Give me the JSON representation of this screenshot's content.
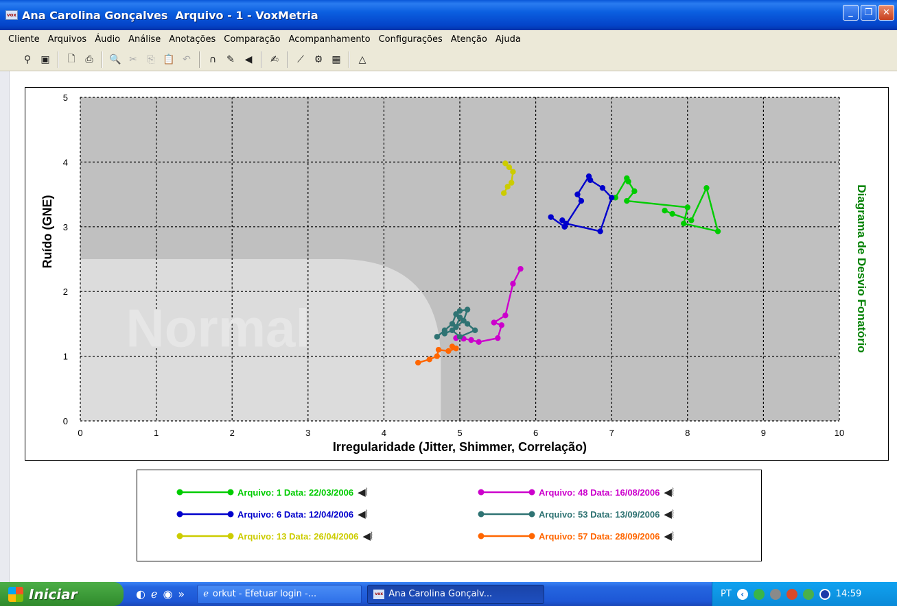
{
  "window": {
    "title": "Ana Carolina Gonçalves  Arquivo - 1 - VoxMetria",
    "icon": "vox",
    "buttons": {
      "minimize": "_",
      "maximize": "❐",
      "close": "✕"
    }
  },
  "menu": [
    "Cliente",
    "Arquivos",
    "Áudio",
    "Análise",
    "Anotações",
    "Comparação",
    "Acompanhamento",
    "Configurações",
    "Atenção",
    "Ajuda"
  ],
  "toolbar": [
    {
      "icon": "patient-icon",
      "glyph": "⚲"
    },
    {
      "icon": "monitor-icon",
      "glyph": "▣"
    },
    {
      "sep": true
    },
    {
      "icon": "print-preview-icon",
      "glyph": "🗋"
    },
    {
      "icon": "print-icon",
      "glyph": "⎙"
    },
    {
      "sep": true
    },
    {
      "icon": "zoom-icon",
      "glyph": "🔍",
      "disabled": true
    },
    {
      "icon": "cut-icon",
      "glyph": "✂",
      "disabled": true
    },
    {
      "icon": "copy-icon",
      "glyph": "⎘",
      "disabled": true
    },
    {
      "icon": "paste-icon",
      "glyph": "📋",
      "disabled": true
    },
    {
      "icon": "undo-icon",
      "glyph": "↶",
      "disabled": true
    },
    {
      "sep": true
    },
    {
      "icon": "headphones-icon",
      "glyph": "∩"
    },
    {
      "icon": "microphone-icon",
      "glyph": "✎"
    },
    {
      "icon": "speaker-icon",
      "glyph": "◀"
    },
    {
      "sep": true
    },
    {
      "icon": "notes-icon",
      "glyph": "✍"
    },
    {
      "sep": true
    },
    {
      "icon": "diagram-icon",
      "glyph": "⟋"
    },
    {
      "icon": "settings-icon",
      "glyph": "⚙"
    },
    {
      "icon": "spectrogram-icon",
      "glyph": "▦"
    },
    {
      "sep": true
    },
    {
      "icon": "comparison-icon",
      "glyph": "△"
    }
  ],
  "chart_data": {
    "type": "line",
    "title": "Diagrama de Desvio Fonatório",
    "xlabel": "Irregularidade (Jitter, Shimmer, Correlação)",
    "ylabel": "Ruído (GNE)",
    "xlim": [
      0,
      10
    ],
    "ylim": [
      0,
      5
    ],
    "xticks": [
      0,
      1,
      2,
      3,
      4,
      5,
      6,
      7,
      8,
      9,
      10
    ],
    "yticks": [
      0,
      1,
      2,
      3,
      4,
      5
    ],
    "grid": true,
    "normal_region_label": "Normal",
    "normal_region": {
      "x_max": 4.75,
      "y_max": 2.5
    },
    "colors": {
      "background": "#c0c0c0",
      "normal": "#dcdcdc",
      "title": "#008000"
    },
    "series": [
      {
        "name": "Arquivo: 1 Data: 22/03/2006",
        "color": "#00cc00",
        "x": [
          7.05,
          7.2,
          7.22,
          7.3,
          7.2,
          8.0,
          7.95,
          8.4,
          8.25,
          8.05,
          7.8,
          7.7
        ],
        "y": [
          3.45,
          3.75,
          3.7,
          3.55,
          3.4,
          3.3,
          3.05,
          2.93,
          3.6,
          3.1,
          3.2,
          3.25
        ]
      },
      {
        "name": "Arquivo: 6 Data: 12/04/2006",
        "color": "#0000cc",
        "x": [
          6.2,
          6.38,
          6.6,
          6.55,
          6.7,
          6.72,
          6.88,
          7.0,
          6.85,
          6.4,
          6.35
        ],
        "y": [
          3.15,
          3.0,
          3.4,
          3.5,
          3.78,
          3.72,
          3.6,
          3.45,
          2.93,
          3.05,
          3.1
        ]
      },
      {
        "name": "Arquivo: 13 Data: 26/04/2006",
        "color": "#cccc00",
        "x": [
          5.6,
          5.65,
          5.7,
          5.68,
          5.63,
          5.58
        ],
        "y": [
          3.98,
          3.92,
          3.85,
          3.68,
          3.62,
          3.52
        ]
      },
      {
        "name": "Arquivo: 48 Data: 16/08/2006",
        "color": "#cc00cc",
        "x": [
          4.95,
          5.05,
          5.15,
          5.25,
          5.5,
          5.55,
          5.45,
          5.6,
          5.7,
          5.8
        ],
        "y": [
          1.28,
          1.27,
          1.25,
          1.22,
          1.28,
          1.48,
          1.52,
          1.63,
          2.12,
          2.35
        ]
      },
      {
        "name": "Arquivo: 53 Data: 13/09/2006",
        "color": "#2f7373",
        "x": [
          4.7,
          4.8,
          4.9,
          4.95,
          5.0,
          5.1,
          5.05,
          4.95,
          5.0,
          5.1,
          5.2,
          5.0,
          4.9,
          4.8
        ],
        "y": [
          1.3,
          1.4,
          1.5,
          1.65,
          1.7,
          1.72,
          1.55,
          1.45,
          1.6,
          1.5,
          1.4,
          1.3,
          1.4,
          1.35
        ]
      },
      {
        "name": "Arquivo: 57 Data: 28/09/2006",
        "color": "#ff6600",
        "x": [
          4.45,
          4.6,
          4.7,
          4.72,
          4.85,
          4.95,
          4.9
        ],
        "y": [
          0.9,
          0.95,
          1.0,
          1.1,
          1.08,
          1.12,
          1.15
        ]
      }
    ]
  },
  "legend": {
    "speaker_glyph": "◀⦚"
  },
  "taskbar": {
    "start_label": "Iniciar",
    "quicklaunch": [
      "◐",
      "ℯ",
      "◉",
      "»"
    ],
    "tasks": [
      "orkut - Efetuar login -...",
      "Ana Carolina Gonçalv..."
    ],
    "lang": "PT",
    "clock": "14:59"
  }
}
